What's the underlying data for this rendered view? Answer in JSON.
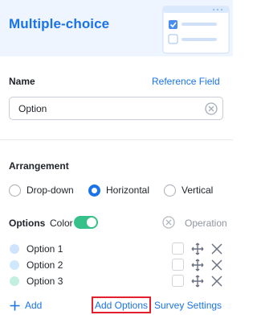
{
  "header": {
    "title": "Multiple-choice"
  },
  "name": {
    "label": "Name",
    "reference_link": "Reference Field",
    "value": "Option"
  },
  "arrangement": {
    "label": "Arrangement",
    "choices": [
      "Drop-down",
      "Horizontal",
      "Vertical"
    ],
    "selected": "Horizontal"
  },
  "options": {
    "label": "Options",
    "color_label": "Color",
    "color_enabled": true,
    "operation_label": "Operation",
    "items": [
      {
        "label": "Option 1",
        "color": "#cfe3fb"
      },
      {
        "label": "Option 2",
        "color": "#cfe8fb"
      },
      {
        "label": "Option 3",
        "color": "#c3efe0"
      }
    ]
  },
  "footer": {
    "add_label": "Add",
    "add_options_label": "Add Options",
    "survey_settings_label": "Survey Settings"
  },
  "colors": {
    "accent": "#1a73e8",
    "toggle_on": "#36c08a",
    "highlight_border": "#e5202e"
  }
}
